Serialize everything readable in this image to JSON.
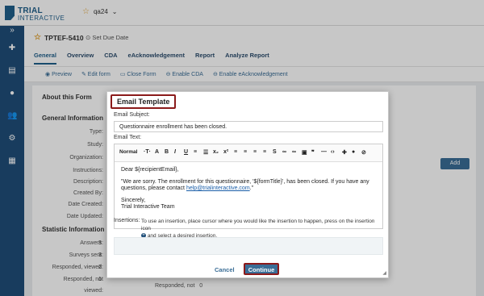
{
  "app": {
    "logo_line1": "TRIAL",
    "logo_line2": "INTERACTIVE",
    "project": "qa24"
  },
  "record": {
    "id": "TPTEF-5410",
    "set_due_date": "Set Due Date"
  },
  "tabs": [
    "General",
    "Overview",
    "CDA",
    "eAcknowledgement",
    "Report",
    "Analyze Report"
  ],
  "actions": [
    "Preview",
    "Edit form",
    "Close Form",
    "Enable CDA",
    "Enable eAcknowledgement"
  ],
  "about": {
    "title": "About this Form",
    "general_title": "General Information",
    "fields": [
      "Type:",
      "Study:",
      "Organization:",
      "Instructions:",
      "Description:",
      "Created By:",
      "Date Created:",
      "Date Updated:"
    ],
    "add_label": "Add"
  },
  "statistics": {
    "title": "Statistic Information",
    "rows": [
      {
        "label": "Answers:",
        "value": "3"
      },
      {
        "label": "Surveys sent:",
        "value": "3"
      },
      {
        "label": "Responded, viewed:",
        "value": "2"
      },
      {
        "label": "Responded, not",
        "value": "1"
      },
      {
        "label": "viewed:",
        "value": ""
      }
    ],
    "responded_not": "Responded, not",
    "responded_not_value": "0"
  },
  "modal": {
    "title": "Email Template",
    "subject_label": "Email Subject:",
    "subject_value": "Questionnaire enrollment has been closed.",
    "text_label": "Email Text:",
    "toolbar_format": "Normal",
    "body_line1": "Dear ${recipientEmail},",
    "body_line2_a": "\"We are sorry. The enrollment for this questionnaire, '${formTitle}', has been closed. If you have any questions, please contact ",
    "body_link": "help@trialinteractive.com",
    "body_line2_b": ".\"",
    "body_sign1": "Sincerely,",
    "body_sign2": "Trial Interactive Team",
    "insertions_label": "Insertions:",
    "insertions_help_a": "To use an insertion, place cursor where you would like the insertion to happen, press on the insertion icon",
    "insertions_help_b": "and select a desired insertion.",
    "cancel_label": "Cancel",
    "continue_label": "Continue"
  }
}
